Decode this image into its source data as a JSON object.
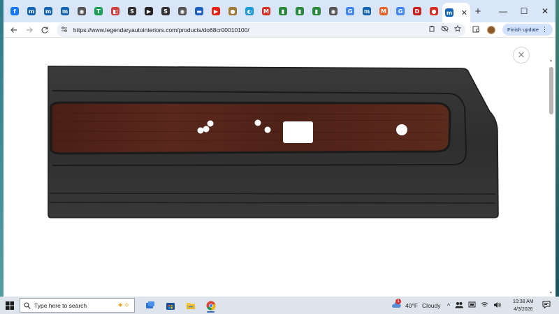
{
  "tabs": [
    {
      "icon": "facebook-icon",
      "glyph": "f",
      "color": "#1877f2"
    },
    {
      "icon": "tab-m-icon",
      "glyph": "m",
      "color": "#1464b4"
    },
    {
      "icon": "tab-m-icon",
      "glyph": "m",
      "color": "#1464b4"
    },
    {
      "icon": "tab-m-icon",
      "glyph": "m",
      "color": "#1464b4"
    },
    {
      "icon": "globe-icon",
      "glyph": "◉",
      "color": "#555555"
    },
    {
      "icon": "sheets-icon",
      "glyph": "T",
      "color": "#1e9e55"
    },
    {
      "icon": "store-icon",
      "glyph": "◧",
      "color": "#d04040"
    },
    {
      "icon": "s-icon",
      "glyph": "S",
      "color": "#333333"
    },
    {
      "icon": "media-icon",
      "glyph": "▶",
      "color": "#222222"
    },
    {
      "icon": "s-icon",
      "glyph": "S",
      "color": "#333333"
    },
    {
      "icon": "globe-icon",
      "glyph": "◉",
      "color": "#555555"
    },
    {
      "icon": "car-icon",
      "glyph": "▬",
      "color": "#1f5fbf"
    },
    {
      "icon": "youtube-icon",
      "glyph": "▶",
      "color": "#e62117"
    },
    {
      "icon": "badge-icon",
      "glyph": "●",
      "color": "#a07a38"
    },
    {
      "icon": "edge-icon",
      "glyph": "◐",
      "color": "#1a9ad6"
    },
    {
      "icon": "gmail-icon",
      "glyph": "M",
      "color": "#d93025"
    },
    {
      "icon": "bag-icon",
      "glyph": "▮",
      "color": "#2b8a3e"
    },
    {
      "icon": "bag-icon",
      "glyph": "▮",
      "color": "#2b8a3e"
    },
    {
      "icon": "bag-icon",
      "glyph": "▮",
      "color": "#2b8a3e"
    },
    {
      "icon": "globe-icon",
      "glyph": "◉",
      "color": "#555555"
    },
    {
      "icon": "google-icon",
      "glyph": "G",
      "color": "#4285f4"
    },
    {
      "icon": "tab-m-icon",
      "glyph": "m",
      "color": "#1464b4"
    },
    {
      "icon": "mu-icon",
      "glyph": "M",
      "color": "#e8622a"
    },
    {
      "icon": "google-icon",
      "glyph": "G",
      "color": "#4285f4"
    },
    {
      "icon": "d-icon",
      "glyph": "D",
      "color": "#c5221f"
    },
    {
      "icon": "pin-icon",
      "glyph": "●",
      "color": "#d93025"
    }
  ],
  "active_tab": {
    "icon": "tab-m-icon",
    "glyph": "m",
    "color": "#1464b4",
    "close": "✕"
  },
  "new_tab": "+",
  "window": {
    "minimize": "—",
    "maximize": "☐",
    "close": "✕"
  },
  "omnibox": {
    "url": "https://www.legendaryautointeriors.com/products/do68cr00010100/"
  },
  "toolbar": {
    "finish_update": "Finish update"
  },
  "content": {
    "close": "✕"
  },
  "taskbar": {
    "search_placeholder": "Type here to search",
    "weather_temp": "40°F",
    "weather_desc": "Cloudy",
    "weather_badge": "1",
    "time": "10:38 AM",
    "date": "4/3/2026"
  }
}
